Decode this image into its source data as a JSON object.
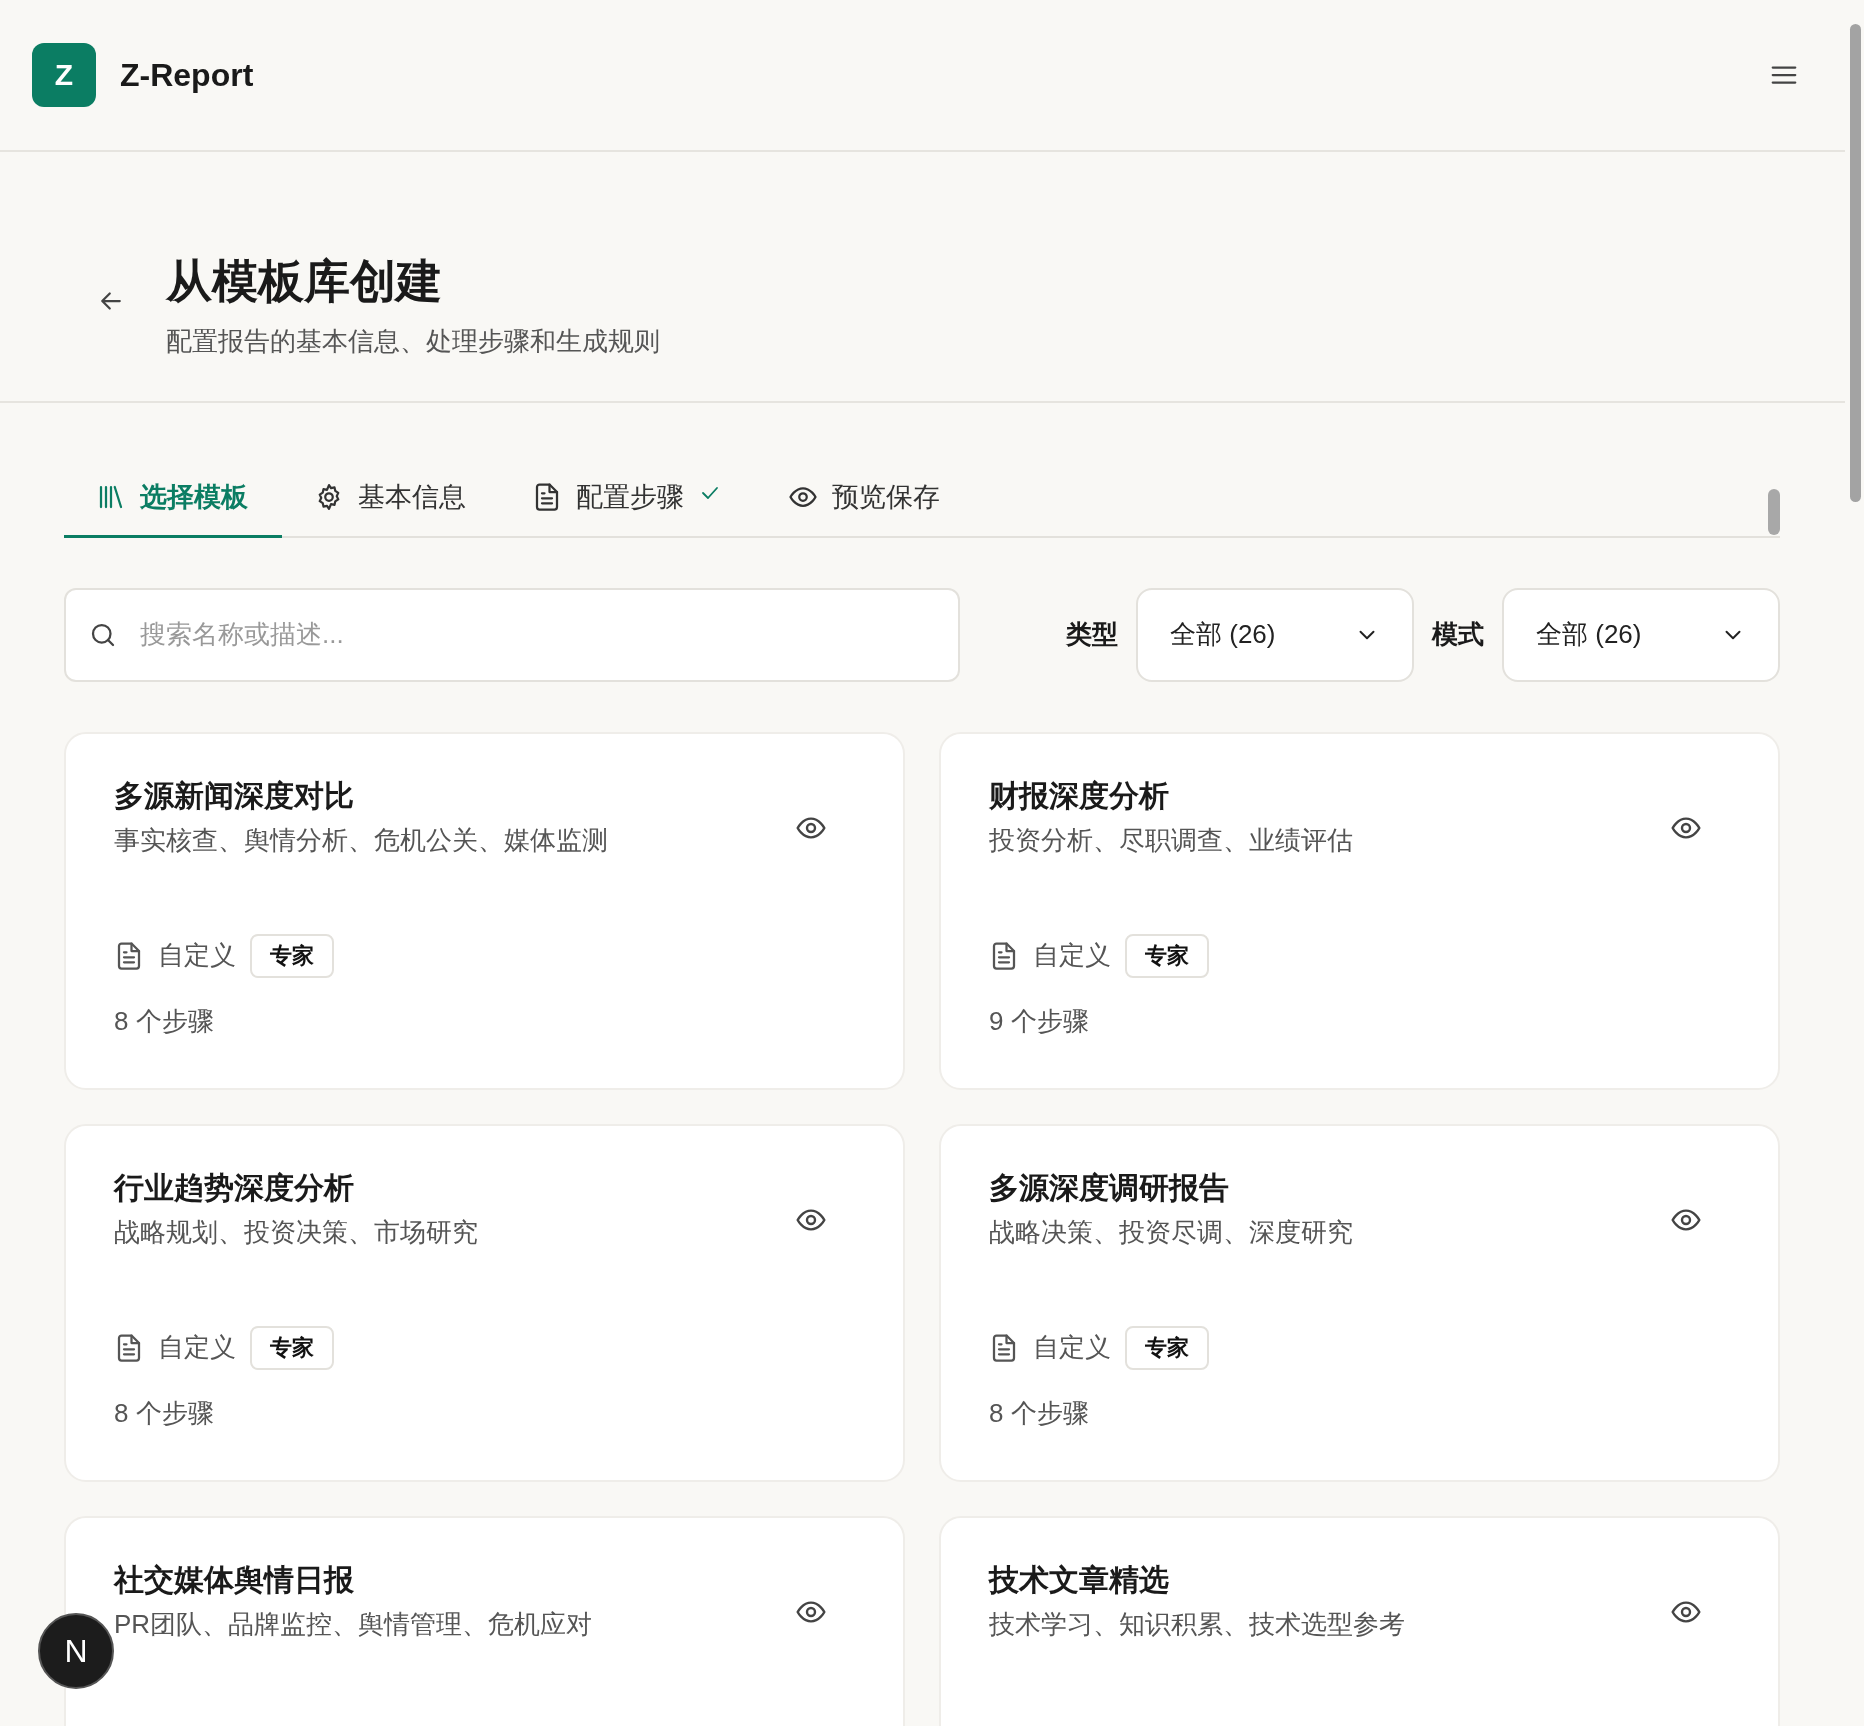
{
  "app": {
    "logo_letter": "Z",
    "name": "Z-Report"
  },
  "page": {
    "title": "从模板库创建",
    "subtitle": "配置报告的基本信息、处理步骤和生成规则"
  },
  "tabs": [
    {
      "label": "选择模板",
      "selected": true,
      "completed": false
    },
    {
      "label": "基本信息",
      "selected": false,
      "completed": false
    },
    {
      "label": "配置步骤",
      "selected": false,
      "completed": true
    },
    {
      "label": "预览保存",
      "selected": false,
      "completed": false
    }
  ],
  "search": {
    "placeholder": "搜索名称或描述..."
  },
  "filters": [
    {
      "label": "类型",
      "value": "全部 (26)"
    },
    {
      "label": "模式",
      "value": "全部 (26)"
    }
  ],
  "templates": [
    {
      "title": "多源新闻深度对比",
      "description": "事实核查、舆情分析、危机公关、媒体监测",
      "type": "自定义",
      "badge": "专家",
      "steps": "8 个步骤"
    },
    {
      "title": "财报深度分析",
      "description": "投资分析、尽职调查、业绩评估",
      "type": "自定义",
      "badge": "专家",
      "steps": "9 个步骤"
    },
    {
      "title": "行业趋势深度分析",
      "description": "战略规划、投资决策、市场研究",
      "type": "自定义",
      "badge": "专家",
      "steps": "8 个步骤"
    },
    {
      "title": "多源深度调研报告",
      "description": "战略决策、投资尽调、深度研究",
      "type": "自定义",
      "badge": "专家",
      "steps": "8 个步骤"
    },
    {
      "title": "社交媒体舆情日报",
      "description": "PR团队、品牌监控、舆情管理、危机应对"
    },
    {
      "title": "技术文章精选",
      "description": "技术学习、知识积累、技术选型参考"
    }
  ],
  "floating_button": {
    "letter": "N"
  }
}
